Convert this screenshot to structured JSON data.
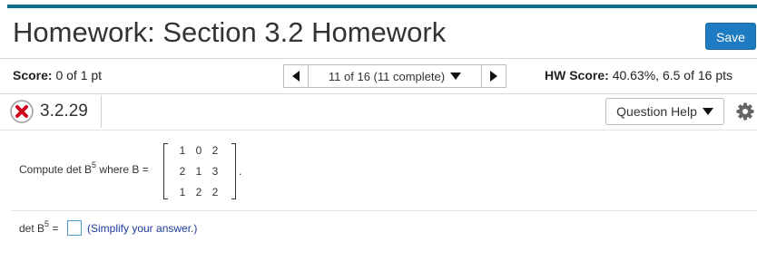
{
  "header": {
    "title": "Homework: Section 3.2 Homework",
    "save_label": "Save"
  },
  "score_bar": {
    "score_label": "Score:",
    "score_value": "0 of 1 pt",
    "nav_label": "11 of 16 (11 complete)",
    "hw_score_label": "HW Score:",
    "hw_score_value": "40.63%, 6.5 of 16 pts"
  },
  "question": {
    "number": "3.2.29",
    "status": "incorrect",
    "help_label": "Question Help"
  },
  "problem": {
    "prompt_start": "Compute det B",
    "exponent": "5",
    "prompt_end": " where B =",
    "matrix": [
      [
        "1",
        "0",
        "2"
      ],
      [
        "2",
        "1",
        "3"
      ],
      [
        "1",
        "2",
        "2"
      ]
    ],
    "period": "."
  },
  "answer": {
    "label_start": "det B",
    "exponent": "5",
    "label_end": " =",
    "value": "",
    "hint": "(Simplify your answer.)"
  },
  "colors": {
    "accent_bar": "#0c6e8e",
    "save_button": "#1f7bc1",
    "error_icon": "#d0021b",
    "hint_text": "#1c3a9c",
    "input_border": "#4e9ad0"
  }
}
